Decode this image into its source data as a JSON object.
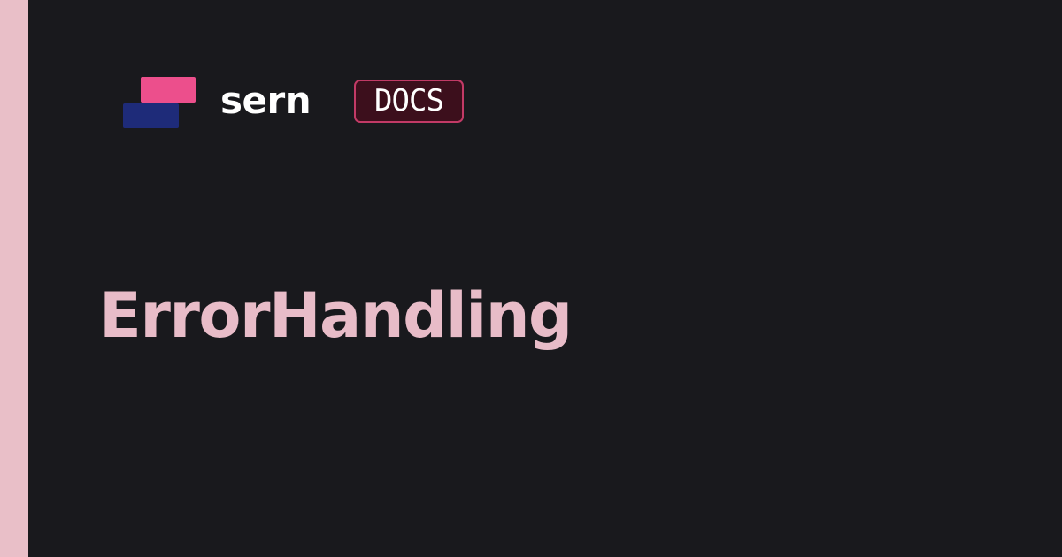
{
  "brand": {
    "name": "sern",
    "badge": "DOCS",
    "logo_icon": "sern-logo-icon"
  },
  "page": {
    "title": "ErrorHandling"
  },
  "colors": {
    "background": "#19191d",
    "accent_stripe": "#e9bfc8",
    "logo_pink": "#ec4f8c",
    "logo_navy": "#1e2b79",
    "badge_border": "#c23a66",
    "badge_fill": "#3c0f1c",
    "title_text": "#e8bcc8",
    "brand_text": "#ffffff"
  }
}
